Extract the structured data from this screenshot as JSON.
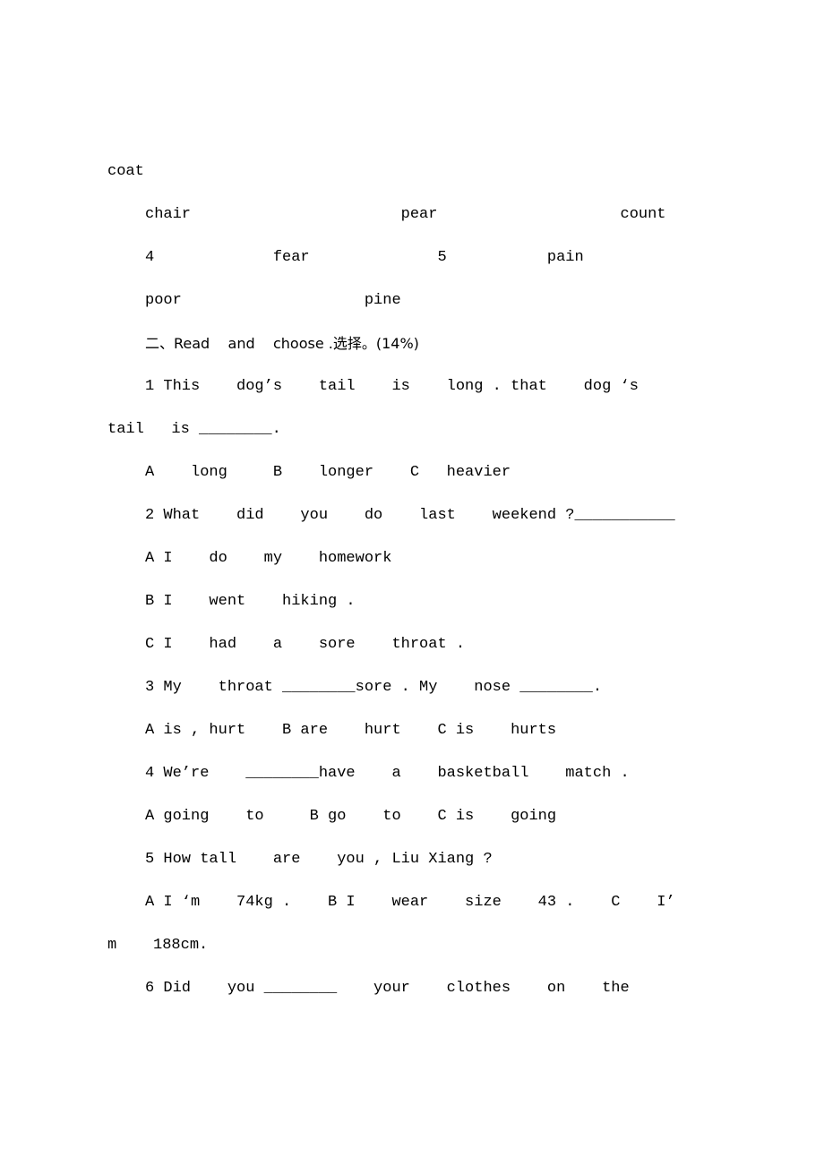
{
  "document": {
    "lines": [
      {
        "id": "l1",
        "indent": "none",
        "text": "coat"
      },
      {
        "id": "l2",
        "indent": "normal",
        "text": "chair                       pear                    count"
      },
      {
        "id": "l3",
        "indent": "normal",
        "text": "4             fear              5           pain"
      },
      {
        "id": "l4",
        "indent": "normal",
        "text": "poor                    pine"
      },
      {
        "id": "l5",
        "indent": "normal",
        "text": "二、Read    and    choose .选择。(14%)"
      },
      {
        "id": "l6",
        "indent": "normal",
        "text": "1 This    dog’s    tail    is    long . that    dog ‘s"
      },
      {
        "id": "l7",
        "indent": "none",
        "text": "tail   is ________."
      },
      {
        "id": "l8",
        "indent": "normal",
        "text": "A    long     B    longer    C   heavier"
      },
      {
        "id": "l9",
        "indent": "normal",
        "text": "2 What    did    you    do    last    weekend ?___________"
      },
      {
        "id": "l10",
        "indent": "normal",
        "text": "A I    do    my    homework"
      },
      {
        "id": "l11",
        "indent": "normal",
        "text": "B I    went    hiking ."
      },
      {
        "id": "l12",
        "indent": "normal",
        "text": "C I    had    a    sore    throat ."
      },
      {
        "id": "l13",
        "indent": "normal",
        "text": "3 My    throat ________sore . My    nose ________."
      },
      {
        "id": "l14",
        "indent": "normal",
        "text": "A is , hurt    B are    hurt    C is    hurts"
      },
      {
        "id": "l15",
        "indent": "normal",
        "text": "4 We’re    ________have    a    basketball    match ."
      },
      {
        "id": "l16",
        "indent": "normal",
        "text": "A going    to     B go    to    C is    going"
      },
      {
        "id": "l17",
        "indent": "normal",
        "text": "5 How tall    are    you , Liu Xiang ?"
      },
      {
        "id": "l18",
        "indent": "normal",
        "text": "A I ‘m    74kg .    B I    wear    size    43 .    C    I’"
      },
      {
        "id": "l19",
        "indent": "none",
        "text": "m    188cm."
      },
      {
        "id": "l20",
        "indent": "normal",
        "text": "6 Did    you ________    your    clothes    on    the"
      }
    ]
  }
}
